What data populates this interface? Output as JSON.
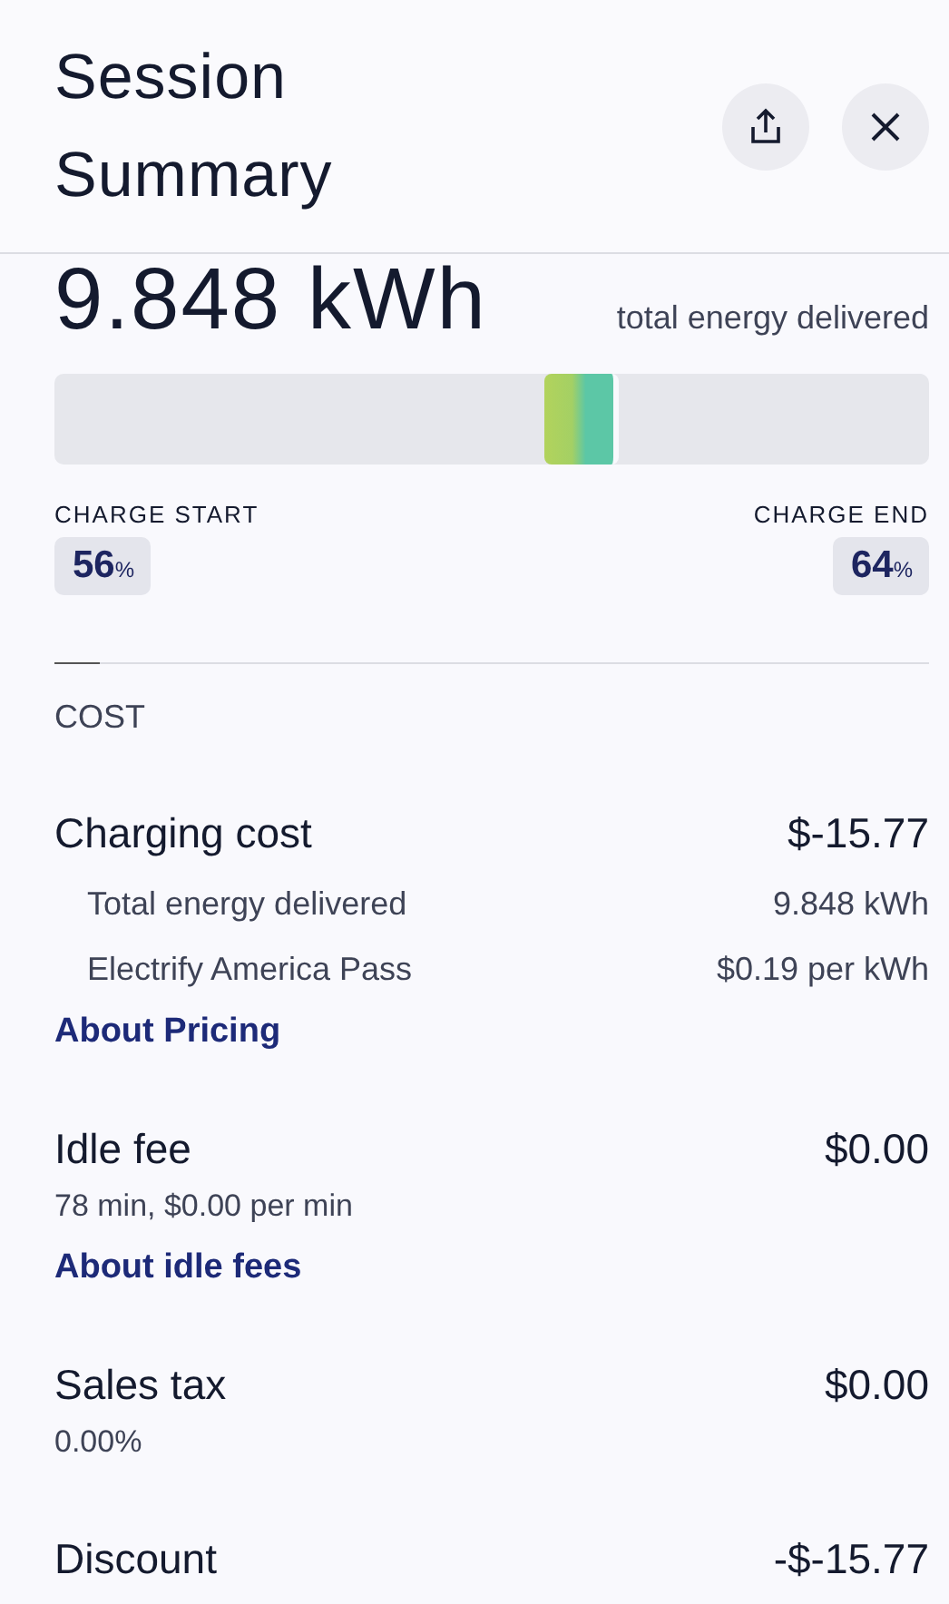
{
  "header": {
    "title": "Session Summary"
  },
  "energy": {
    "value": "9.848 kWh",
    "caption": "total energy delivered"
  },
  "charge_start": {
    "label": "CHARGE START",
    "value": "56",
    "unit": "%",
    "level": 0.56
  },
  "charge_end": {
    "label": "CHARGE END",
    "value": "64",
    "unit": "%",
    "level": 0.64
  },
  "cost": {
    "heading": "COST",
    "items": [
      {
        "label": "Charging cost",
        "amount": "$-15.77",
        "details": [
          {
            "label": "Total energy delivered",
            "value": "9.848 kWh"
          },
          {
            "label": "Electrify America Pass",
            "value": "$0.19 per kWh"
          }
        ],
        "link": "About Pricing"
      },
      {
        "label": "Idle fee",
        "amount": "$0.00",
        "note": "78 min, $0.00 per min",
        "link": "About idle fees"
      },
      {
        "label": "Sales tax",
        "amount": "$0.00",
        "note": "0.00%"
      },
      {
        "label": "Discount",
        "amount": "-$-15.77"
      }
    ]
  }
}
